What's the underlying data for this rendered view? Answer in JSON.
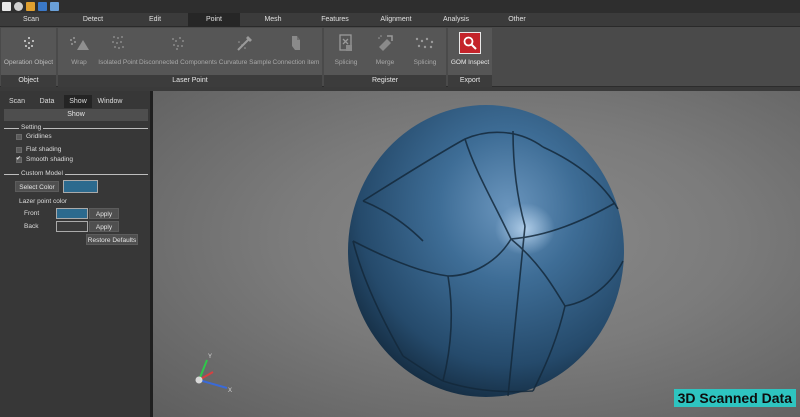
{
  "menu": {
    "tabs": [
      {
        "label": "Scan"
      },
      {
        "label": "Detect"
      },
      {
        "label": "Edit"
      },
      {
        "label": "Point",
        "active": true
      },
      {
        "label": "Mesh"
      },
      {
        "label": "Features"
      },
      {
        "label": "Alignment"
      },
      {
        "label": "Analysis"
      },
      {
        "label": "Other"
      }
    ]
  },
  "ribbon": {
    "groups": [
      {
        "label": "Object",
        "buttons": [
          {
            "label": "Operation Object",
            "icon": "operation-object-icon"
          }
        ]
      },
      {
        "label": "Laser Point",
        "buttons": [
          {
            "label": "Wrap",
            "icon": "wrap-icon"
          },
          {
            "label": "Isolated Point",
            "icon": "isolated-point-icon"
          },
          {
            "label": "Disconnected Components",
            "icon": "disconnected-components-icon"
          },
          {
            "label": "Curvature Sample",
            "icon": "curvature-sample-icon"
          },
          {
            "label": "Connection item",
            "icon": "connection-item-icon"
          }
        ]
      },
      {
        "label": "Register",
        "buttons": [
          {
            "label": "Splicing",
            "icon": "splicing-icon"
          },
          {
            "label": "Merge",
            "icon": "merge-icon"
          },
          {
            "label": "Splicing",
            "icon": "splicing-points-icon"
          }
        ]
      },
      {
        "label": "Export",
        "buttons": [
          {
            "label": "GOM Inspect",
            "icon": "gom-inspect-icon"
          }
        ]
      }
    ]
  },
  "panel": {
    "tabs": [
      {
        "label": "Scan"
      },
      {
        "label": "Data"
      },
      {
        "label": "Show",
        "active": true
      },
      {
        "label": "Window"
      }
    ],
    "header": "Show",
    "setting": {
      "title": "Setting",
      "options": [
        {
          "label": "Gridlines",
          "checked": false
        },
        {
          "label": "Flat shading",
          "checked": false
        },
        {
          "label": "Smooth shading",
          "checked": true
        }
      ]
    },
    "custom_model": {
      "title": "Custom Model",
      "select_color_label": "Select Color",
      "model_color": "#2c6a8e",
      "lazer_title": "Lazer point color",
      "front_label": "Front",
      "front_color": "#2c6a8e",
      "back_label": "Back",
      "back_color": "#3a3a3a",
      "apply_label": "Apply",
      "restore_label": "Restore Defaults"
    }
  },
  "viewport": {
    "watermark": "3D Scanned Data",
    "model_color": "#2d5b80",
    "background": "#7f7f7f"
  },
  "colors": {
    "gom_inspect_accent": "#c4242b",
    "watermark_bg": "#2ec4c0"
  }
}
